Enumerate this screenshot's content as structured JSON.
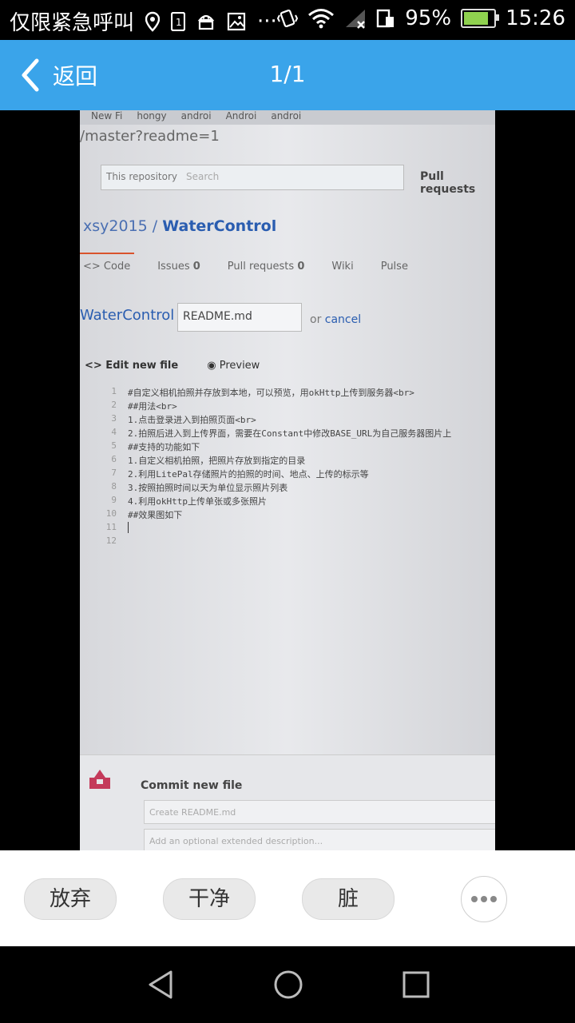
{
  "status_bar": {
    "alert_text": "仅限紧急呼叫",
    "more_indicator": "···",
    "battery_percent": "95%",
    "time": "15:26",
    "icons": [
      "location-icon",
      "sim-icon",
      "android-icon",
      "image-icon",
      "vibrate-icon",
      "wifi-icon",
      "signal-icon",
      "data-saver-icon",
      "battery-icon"
    ]
  },
  "app_bar": {
    "back_label": "返回",
    "page_count": "1/1",
    "background": "#3aa4ea"
  },
  "photo": {
    "browser_tabs": [
      "New Fi",
      "hongy",
      "androi",
      "Androi",
      "androi"
    ],
    "url": "/master?readme=1",
    "this_repository": "This repository",
    "search_placeholder": "Search",
    "pull_requests_nav": "Pull requests",
    "repo_owner": "xsy2015",
    "repo_sep": " / ",
    "repo_name": "WaterControl",
    "tabs": {
      "code": "<> Code",
      "issues": "Issues",
      "issues_count": "0",
      "pulls": "Pull requests",
      "pulls_count": "0",
      "wiki": "Wiki",
      "pulse": "Pulse"
    },
    "breadcrumb": "WaterControl",
    "breadcrumb_sep": " /",
    "filename": "README.md",
    "or_text": "or",
    "cancel_text": "cancel",
    "edit_tab": "<> Edit new file",
    "preview_tab": "Preview",
    "code_lines": [
      {
        "n": "1",
        "text": "#自定义相机拍照并存放到本地，可以预览，用okHttp上传到服务器<br>"
      },
      {
        "n": "2",
        "text": "##用法<br>"
      },
      {
        "n": "3",
        "text": "1.点击登录进入到拍照页面<br>"
      },
      {
        "n": "4",
        "text": "2.拍照后进入到上传界面，需要在Constant中修改BASE_URL为自己服务器图片上"
      },
      {
        "n": "5",
        "text": "##支持的功能如下"
      },
      {
        "n": "6",
        "text": " 1.自定义相机拍照，把照片存放到指定的目录"
      },
      {
        "n": "7",
        "text": " 2.利用LitePal存储照片的拍照的时间、地点、上传的标示等"
      },
      {
        "n": "8",
        "text": " 3.按照拍照时间以天为单位显示照片列表"
      },
      {
        "n": "9",
        "text": " 4.利用okHttp上传单张或多张照片"
      },
      {
        "n": "10",
        "text": " ##效果图如下"
      },
      {
        "n": "11",
        "text": ""
      },
      {
        "n": "12",
        "text": ""
      }
    ],
    "commit_title": "Commit new file",
    "commit_placeholder": "Create README.md",
    "description_placeholder": "Add an optional extended description..."
  },
  "actions": {
    "discard": "放弃",
    "clean": "干净",
    "dirty": "脏"
  }
}
